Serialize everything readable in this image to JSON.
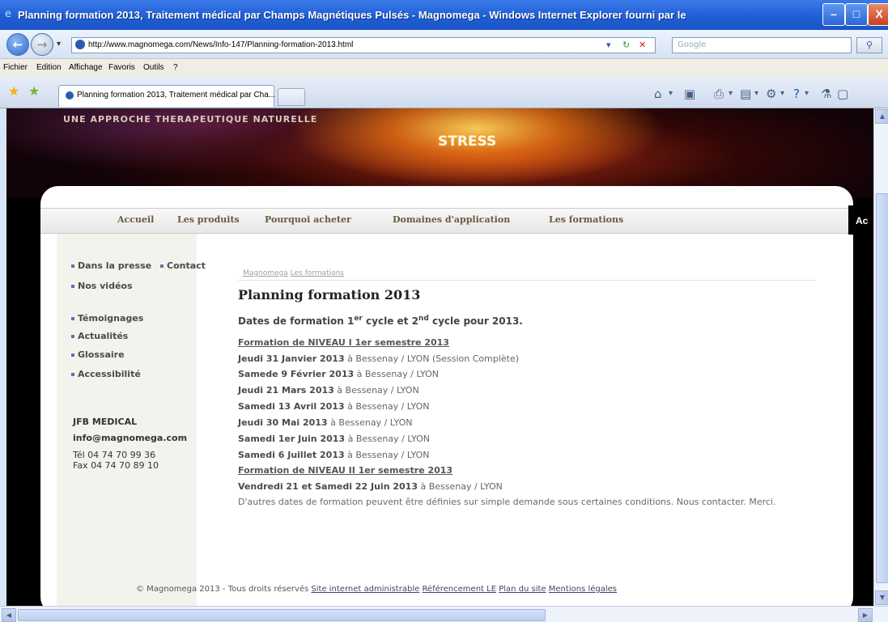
{
  "window": {
    "title": "Planning formation 2013, Traitement médical par Champs Magnétiques Pulsés - Magnomega - Windows Internet Explorer fourni par le",
    "min": "–",
    "max": "□",
    "close": "X"
  },
  "address": {
    "url": "http://www.magnomega.com/News/Info-147/Planning-formation-2013.html",
    "search_placeholder": "Google",
    "dropdown": "▾",
    "refresh": "↻",
    "stop": "✕"
  },
  "menu": [
    "Fichier",
    "Edition",
    "Affichage",
    "Favoris",
    "Outils",
    "?"
  ],
  "tab": {
    "label": "Planning formation 2013, Traitement médical par Cha..."
  },
  "toolbar_icons": [
    "home-icon",
    "feeds-icon",
    "print-icon",
    "page-icon",
    "tools-icon",
    "help-icon",
    "research-icon",
    "zoom-icon"
  ],
  "banner": {
    "tagline": "UNE APPROCHE THERAPEUTIQUE NATURELLE",
    "stress": "STRESS"
  },
  "nav": {
    "items": [
      "Accueil",
      "Les produits",
      "Pourquoi acheter",
      "Domaines d'application",
      "Les formations"
    ],
    "right": "Ac"
  },
  "sidebar": {
    "items": [
      {
        "label": "Dans la presse"
      },
      {
        "label": "Contact"
      },
      {
        "label": "Nos vidéos"
      },
      {
        "label": "Témoignages"
      },
      {
        "label": "Actualités"
      },
      {
        "label": "Glossaire"
      },
      {
        "label": "Accessibilité"
      }
    ],
    "company": "JFB MEDICAL",
    "email": "info@magnomega.com",
    "tel": "Tél 04 74 70 99 36",
    "fax": "Fax 04 74 70 89 10"
  },
  "breadcrumb": [
    "Magnomega",
    "Les formations"
  ],
  "page": {
    "title": "Planning formation 2013",
    "subtitle_a": "Dates de formation 1",
    "subtitle_sup1": "er",
    "subtitle_b": " cycle et 2",
    "subtitle_sup2": "nd",
    "subtitle_c": " cycle pour 2013.",
    "section1": "Formation de NIVEAU I 1er semestre 2013",
    "rows1": [
      {
        "date": "Jeudi 31 Janvier 2013",
        "place": " à Bessenay / LYON (Session Complète)"
      },
      {
        "date": "Samede 9 Février 2013",
        "place": " à Bessenay / LYON"
      },
      {
        "date": "Jeudi 21 Mars 2013",
        "place": " à Bessenay / LYON"
      },
      {
        "date": "Samedi 13 Avril 2013",
        "place": " à Bessenay / LYON"
      },
      {
        "date": "Jeudi 30 Mai 2013",
        "place": " à Bessenay / LYON"
      },
      {
        "date": "Samedi 1er Juin 2013",
        "place": " à Bessenay / LYON"
      },
      {
        "date": "Samedi 6 Juillet 2013",
        "place": " à Bessenay / LYON"
      }
    ],
    "section2": "Formation de NIVEAU II 1er semestre 2013",
    "rows2": [
      {
        "date": "Vendredi 21 et Samedi 22 Juin 2013",
        "place": " à Bessenay / LYON"
      }
    ],
    "note": "D'autres dates de formation peuvent être définies sur simple demande sous certaines conditions. Nous contacter. Merci."
  },
  "footer": {
    "copyright": "© Magnomega 2013 - Tous droits réservés",
    "links": [
      "Site internet administrable",
      "Référencement LE",
      "Plan du site",
      "Mentions légales"
    ]
  }
}
